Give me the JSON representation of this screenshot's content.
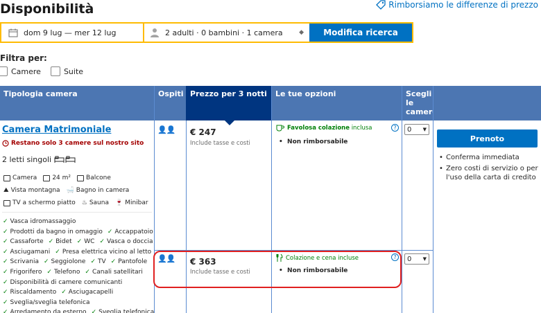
{
  "page": {
    "title": "Disponibilità",
    "price_match": "Rimborsiamo le differenze di prezzo"
  },
  "search": {
    "dates": "dom 9 lug — mer 12 lug",
    "guests": "2 adulti · 0 bambini · 1 camera",
    "button": "Modifica ricerca"
  },
  "filters": {
    "label": "Filtra per:",
    "options": [
      "Camere",
      "Suite"
    ]
  },
  "table": {
    "headers": {
      "room_type": "Tipologia camera",
      "guests": "Ospiti",
      "price": "Prezzo per 3 notti",
      "options": "Le tue opzioni",
      "choose": "Scegli le camere"
    },
    "room": {
      "name": "Camera Matrimoniale",
      "urgency": "Restano solo 3 camere sul nostro sito",
      "beds": "2 letti singoli",
      "facilities": [
        [
          "Camera",
          "24 m²",
          "Balcone"
        ],
        [
          "Vista montagna",
          "Bagno in camera"
        ],
        [
          "TV a schermo piatto",
          "Sauna",
          "Minibar"
        ]
      ],
      "amenities": [
        [
          "Vasca idromassaggio"
        ],
        [
          "Prodotti da bagno in omaggio",
          "Accappatoio"
        ],
        [
          "Cassaforte",
          "Bidet",
          "WC",
          "Vasca o doccia"
        ],
        [
          "Asciugamani",
          "Presa elettrica vicino al letto"
        ],
        [
          "Scrivania",
          "Seggiolone",
          "TV",
          "Pantofole"
        ],
        [
          "Frigorifero",
          "Telefono",
          "Canali satellitari"
        ],
        [
          "Disponibilità di camere comunicanti"
        ],
        [
          "Riscaldamento",
          "Asciugacapelli"
        ],
        [
          "Sveglia/sveglia telefonica"
        ],
        [
          "Arredamento da esterno",
          "Sveglia telefonica"
        ]
      ]
    },
    "rates": [
      {
        "price": "€ 247",
        "price_note": "Include tasse e costi",
        "meal_bold": "Favolosa colazione",
        "meal_rest": "inclusa",
        "policy": "Non rimborsabile",
        "qty": "0"
      },
      {
        "price": "€ 363",
        "price_note": "Include tasse e costi",
        "meal_bold": "",
        "meal_rest": "Colazione e cena incluse",
        "policy": "Non rimborsabile",
        "qty": "0"
      }
    ],
    "book": {
      "button": "Prenoto",
      "bullets": [
        "Conferma immediata",
        "Zero costi di servizio o per l'uso della carta di credito"
      ]
    }
  },
  "colors": {
    "header_bg": "#4c76b2",
    "header_selected_bg": "#003580",
    "primary": "#0071c2",
    "accent_yellow": "#febb02",
    "highlight_red": "#e02020",
    "green": "#008009"
  }
}
